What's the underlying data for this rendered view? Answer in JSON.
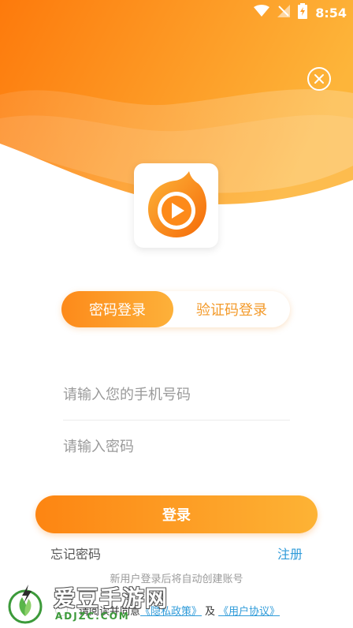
{
  "status_bar": {
    "time": "8:54",
    "icons": [
      "wifi-icon",
      "signal-icon",
      "battery-charging-icon"
    ]
  },
  "header": {
    "close_icon": "close-circle-icon",
    "logo_icon": "flame-play-logo"
  },
  "login_tabs": [
    {
      "label": "密码登录",
      "active": true
    },
    {
      "label": "验证码登录",
      "active": false
    }
  ],
  "form": {
    "phone_placeholder": "请输入您的手机号码",
    "password_placeholder": "请输入密码"
  },
  "login_button": {
    "label": "登录"
  },
  "links": {
    "forgot_password": "忘记密码",
    "register": "注册"
  },
  "hint": "新用户登录后将自动创建账号",
  "agreement": {
    "prefix": "请阅读并同意",
    "privacy_link": "《隐私政策》",
    "and": "及",
    "terms_link": "《用户协议》"
  },
  "watermark": {
    "text": "爱豆手游网",
    "domain": "ADJZC.COM"
  },
  "colors": {
    "accent_orange": "#fd8a1a",
    "accent_light": "#fdb13a",
    "link_blue": "#2f9bd9",
    "placeholder_gray": "#9a9a9a"
  }
}
